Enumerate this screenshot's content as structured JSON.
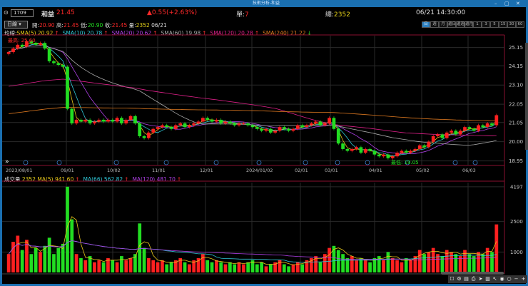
{
  "window": {
    "title": "技術分析-和益",
    "controls": [
      "–",
      "▢",
      "✕"
    ]
  },
  "header": {
    "code": "1709",
    "name": "和益",
    "price": "21.45",
    "change": "▲0.55(+2.63%)",
    "single_label": "單:",
    "single_value": "7",
    "total_label": "總:",
    "total_value": "2352",
    "datetime": "06/21 14:30:00"
  },
  "ohlc": {
    "period": "日線",
    "open_label": "開:",
    "open": "20.90",
    "high_label": "高:",
    "high": "21.45",
    "low_label": "低:",
    "low": "20.90",
    "close_label": "收:",
    "close": "21.45",
    "vol_label": "量:",
    "vol": "2352",
    "date": "06/21"
  },
  "timeframes": [
    "日",
    "週",
    "月",
    "還日",
    "還週",
    "還月",
    "1",
    "3",
    "5",
    "15",
    "30",
    "60"
  ],
  "ma_legend": {
    "prefix": "均線:",
    "items": [
      {
        "label": "SMA(5) 20.92",
        "arrow": "↑",
        "color": "#e6c619"
      },
      {
        "label": "SMA(10) 20.78",
        "arrow": "↑",
        "color": "#2ec8d8"
      },
      {
        "label": "SMA(20) 20.62",
        "arrow": "↑",
        "color": "#b040e8"
      },
      {
        "label": "SMA(60) 19.98",
        "arrow": "↑",
        "color": "#a8a8a8"
      },
      {
        "label": "SMA(120) 20.28",
        "arrow": "↑",
        "color": "#e0208a"
      },
      {
        "label": "SMA(240) 21.22",
        "arrow": "↓",
        "color": "#e07a20"
      }
    ]
  },
  "annotations": {
    "high": "最高: 25.60",
    "low": "最低: 19.05"
  },
  "vol_legend": {
    "prefix": "成交量",
    "value": "2352",
    "items": [
      {
        "label": "MA(5) 941.60",
        "arrow": "↑",
        "color": "#e6c619"
      },
      {
        "label": "MA(66) 562.82",
        "arrow": "↑",
        "color": "#2ec8d8"
      },
      {
        "label": "MA(120) 481.70",
        "arrow": "↑",
        "color": "#b040e8"
      }
    ]
  },
  "colors": {
    "up": "#ff2020",
    "down": "#22dd22",
    "accent": "#1a6fb0"
  },
  "chart_data": {
    "type": "candlestick",
    "price_ticks": [
      "25.15",
      "24.15",
      "23.10",
      "22.05",
      "21.05",
      "20.00",
      "18.95"
    ],
    "price_ylim": [
      18.7,
      25.8
    ],
    "vol_ticks": [
      "4197",
      "2500",
      "1000"
    ],
    "vol_ylim": [
      0,
      4400
    ],
    "date_ticks": [
      "2023/08/01",
      "09/01",
      "10/02",
      "11/01",
      "12/01",
      "2024/01/02",
      "02/01",
      "03/01",
      "04/01",
      "05/02",
      "06/03"
    ],
    "closes": [
      24.9,
      25.1,
      25.3,
      25.2,
      25.5,
      25.4,
      25.3,
      25.4,
      25.1,
      24.4,
      24.3,
      24.2,
      24.1,
      21.8,
      21.0,
      21.2,
      21.1,
      21.2,
      21.0,
      21.1,
      21.2,
      21.1,
      21.2,
      21.1,
      21.3,
      21.0,
      21.2,
      21.4,
      21.0,
      20.3,
      20.2,
      20.5,
      20.7,
      20.8,
      20.9,
      20.8,
      20.7,
      20.9,
      21.0,
      20.8,
      20.9,
      21.0,
      21.1,
      21.3,
      21.2,
      21.1,
      21.2,
      21.0,
      21.1,
      21.0,
      20.9,
      21.0,
      21.0,
      20.9,
      20.8,
      20.7,
      20.6,
      20.7,
      20.5,
      20.6,
      20.8,
      20.7,
      20.6,
      20.7,
      20.9,
      20.8,
      20.9,
      21.0,
      21.1,
      20.9,
      21.0,
      21.3,
      20.7,
      19.9,
      19.6,
      19.5,
      19.6,
      19.7,
      19.4,
      19.6,
      19.5,
      19.3,
      19.2,
      19.3,
      19.1,
      19.2,
      19.4,
      19.5,
      19.4,
      19.5,
      19.6,
      19.8,
      19.7,
      20.0,
      20.3,
      20.4,
      20.2,
      20.5,
      20.6,
      20.4,
      20.6,
      20.8,
      20.7,
      20.6,
      20.9,
      20.8,
      21.0,
      20.9,
      21.45
    ],
    "volumes": [
      900,
      1500,
      1800,
      1100,
      1600,
      900,
      1200,
      1000,
      1300,
      1700,
      900,
      1200,
      1400,
      4197,
      2600,
      900,
      700,
      600,
      800,
      500,
      600,
      500,
      700,
      600,
      500,
      800,
      600,
      700,
      900,
      2400,
      1200,
      700,
      600,
      500,
      600,
      400,
      500,
      600,
      700,
      500,
      400,
      600,
      700,
      900,
      600,
      500,
      600,
      500,
      400,
      500,
      400,
      500,
      400,
      500,
      600,
      400,
      500,
      300,
      400,
      500,
      600,
      400,
      300,
      400,
      500,
      400,
      600,
      700,
      800,
      500,
      900,
      1200,
      1300,
      1100,
      900,
      700,
      800,
      600,
      700,
      600,
      500,
      700,
      800,
      600,
      1000,
      700,
      600,
      500,
      700,
      600,
      800,
      1100,
      900,
      1000,
      1200,
      900,
      800,
      1100,
      1000,
      900,
      800,
      1100,
      900,
      800,
      1000,
      900,
      1200,
      1000,
      2352
    ]
  },
  "toolbar": [
    "☐",
    "⚙",
    "▤",
    "⎙",
    "➤",
    "▥",
    "↖",
    "◉",
    "○",
    "−",
    "+"
  ]
}
